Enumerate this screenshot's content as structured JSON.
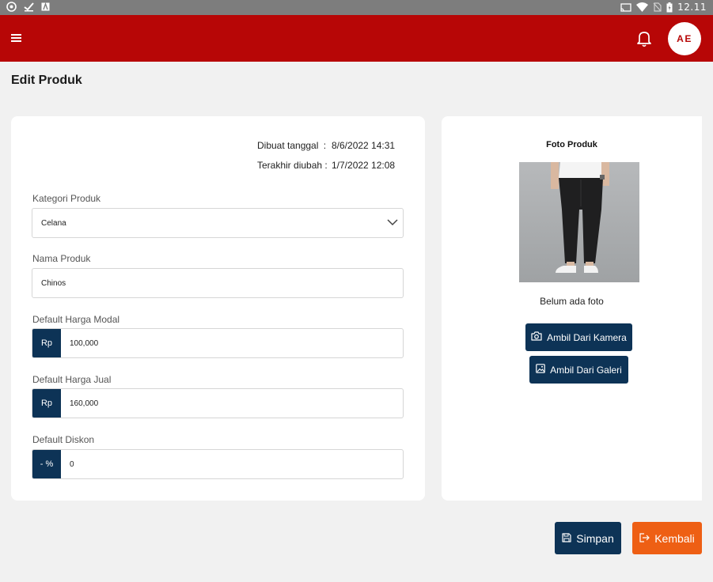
{
  "status_bar": {
    "time": "12.11"
  },
  "header": {
    "avatar_initials": "AE"
  },
  "page": {
    "title": "Edit Produk"
  },
  "meta": {
    "created_label": "Dibuat tanggal",
    "created_sep": ":",
    "created_value": "8/6/2022 14:31",
    "updated_label": "Terakhir diubah",
    "updated_sep": ":",
    "updated_value": "1/7/2022 12:08"
  },
  "form": {
    "category_label": "Kategori Produk",
    "category_value": "Celana",
    "name_label": "Nama Produk",
    "name_value": "Chinos",
    "cost_label": "Default Harga Modal",
    "cost_prefix": "Rp",
    "cost_value": "100,000",
    "price_label": "Default Harga Jual",
    "price_prefix": "Rp",
    "price_value": "160,000",
    "discount_label": "Default Diskon",
    "discount_prefix": "- %",
    "discount_value": "0"
  },
  "photo": {
    "title": "Foto Produk",
    "status": "Belum ada foto",
    "camera_button": "Ambil Dari Kamera",
    "gallery_button": "Ambil Dari Galeri"
  },
  "actions": {
    "save": "Simpan",
    "back": "Kembali"
  },
  "colors": {
    "appbar": "#b70606",
    "primary": "#0d3356",
    "accent": "#ee5f14",
    "background": "#f1f1f1"
  }
}
